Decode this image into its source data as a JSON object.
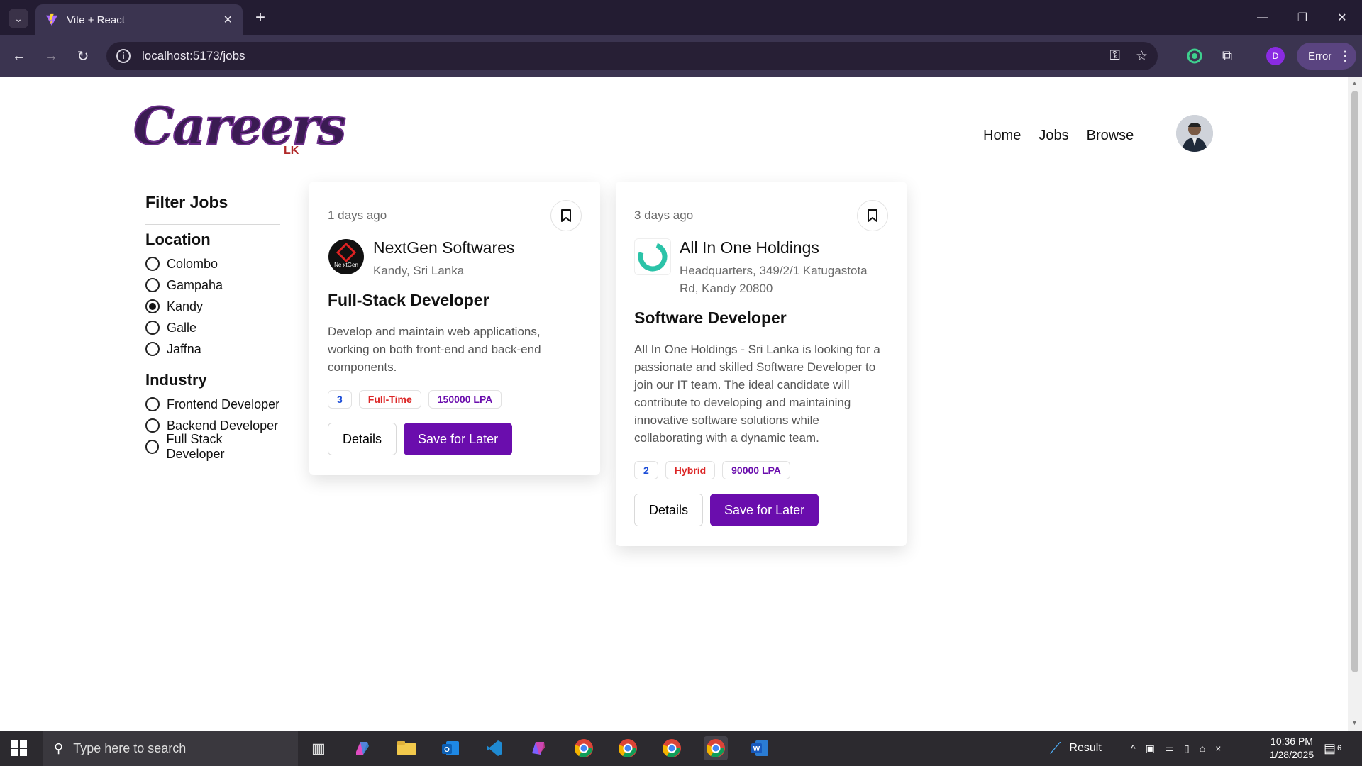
{
  "browser": {
    "tab_title": "Vite + React",
    "url": "localhost:5173/jobs",
    "profile_initial": "D",
    "error_label": "Error"
  },
  "site": {
    "logo_text": "Careers",
    "logo_sub": "LK",
    "nav": [
      "Home",
      "Jobs",
      "Browse"
    ]
  },
  "filters": {
    "title": "Filter Jobs",
    "location_title": "Location",
    "locations": [
      "Colombo",
      "Gampaha",
      "Kandy",
      "Galle",
      "Jaffna"
    ],
    "selected_location": "Kandy",
    "industry_title": "Industry",
    "industries": [
      "Frontend Developer",
      "Backend Developer",
      "Full Stack Developer"
    ]
  },
  "jobs": [
    {
      "posted": "1 days ago",
      "company": "NextGen Softwares",
      "location": "Kandy, Sri Lanka",
      "title": "Full-Stack Developer",
      "description": "Develop and maintain web applications, working on both front-end and back-end components.",
      "positions": "3",
      "job_type": "Full-Time",
      "salary": "150000 LPA",
      "details_label": "Details",
      "save_label": "Save for Later"
    },
    {
      "posted": "3 days ago",
      "company": "All In One Holdings",
      "location": "Headquarters, 349/2/1 Katugastota Rd, Kandy 20800",
      "title": "Software Developer",
      "description": "All In One Holdings - Sri Lanka is looking for a passionate and skilled Software Developer to join our IT team. The ideal candidate will contribute to developing and maintaining innovative software solutions while collaborating with a dynamic team.",
      "positions": "2",
      "job_type": "Hybrid",
      "salary": "90000 LPA",
      "details_label": "Details",
      "save_label": "Save for Later"
    }
  ],
  "taskbar": {
    "search_placeholder": "Type here to search",
    "weather_label": "Result",
    "time": "10:36 PM",
    "date": "1/28/2025",
    "notification_count": "6"
  },
  "colors": {
    "brand_purple": "#6a0dad",
    "badge_blue": "#1d4ed8",
    "badge_red": "#dc2626"
  }
}
